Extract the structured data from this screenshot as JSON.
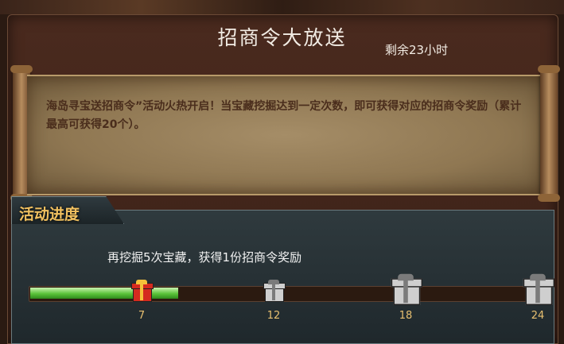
{
  "header": {
    "title": "招商令大放送",
    "timer": "剩余23小时"
  },
  "scroll": {
    "description": "海岛寻宝送招商令”活动火热开启！当宝藏挖掘达到一定次数，即可获得对应的招商令奖励（累计最高可获得20个）。"
  },
  "progress": {
    "section_title": "活动进度",
    "message": "再挖掘5次宝藏，获得1份招商令奖励",
    "current": 7,
    "max": 24,
    "milestones": [
      {
        "value": "7",
        "state": "active",
        "icon": "gift-box-red-icon"
      },
      {
        "value": "12",
        "state": "locked",
        "icon": "gift-box-silver-icon"
      },
      {
        "value": "18",
        "state": "locked",
        "icon": "gift-box-silver-icon"
      },
      {
        "value": "24",
        "state": "locked",
        "icon": "gift-box-silver-icon"
      }
    ],
    "fill_color": "#5bc33a"
  }
}
